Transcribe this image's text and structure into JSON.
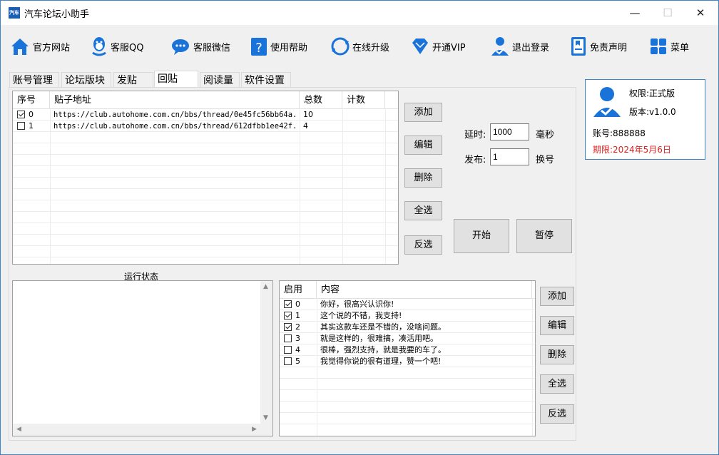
{
  "window": {
    "title": "汽车论坛小助手",
    "icon_text": "汽车",
    "minimize": "—",
    "maximize": "☐",
    "close": "✕"
  },
  "toolbar": [
    {
      "label": "官方网站",
      "icon": "home-icon"
    },
    {
      "label": "客服QQ",
      "icon": "qq-icon"
    },
    {
      "label": "客服微信",
      "icon": "wechat-icon"
    },
    {
      "label": "使用帮助",
      "icon": "help-icon"
    },
    {
      "label": "在线升级",
      "icon": "refresh-icon"
    },
    {
      "label": "开通VIP",
      "icon": "diamond-icon"
    },
    {
      "label": "退出登录",
      "icon": "user-logout-icon"
    },
    {
      "label": "免责声明",
      "icon": "document-icon"
    },
    {
      "label": "菜单",
      "icon": "grid-menu-icon"
    }
  ],
  "tabs": [
    "账号管理",
    "论坛版块",
    "发贴",
    "回贴",
    "阅读量",
    "软件设置"
  ],
  "active_tab": "回贴",
  "posts_table": {
    "headers": [
      "序号",
      "贴子地址",
      "总数",
      "计数"
    ],
    "rows": [
      {
        "checked": true,
        "index": "0",
        "url": "https://club.autohome.com.cn/bbs/thread/0e45fc56bb64a...",
        "total": "10",
        "count": ""
      },
      {
        "checked": false,
        "index": "1",
        "url": "https://club.autohome.com.cn/bbs/thread/612dfbb1ee42f...",
        "total": "4",
        "count": ""
      }
    ]
  },
  "posts_buttons": {
    "add": "添加",
    "edit": "编辑",
    "delete": "删除",
    "select_all": "全选",
    "invert": "反选"
  },
  "settings": {
    "delay_label": "延时:",
    "delay_value": "1000",
    "delay_unit": "毫秒",
    "publish_label": "发布:",
    "publish_value": "1",
    "publish_unit": "换号"
  },
  "actions": {
    "start": "开始",
    "pause": "暂停"
  },
  "account": {
    "permission": "权限:正式版",
    "version": "版本:v1.0.0",
    "account_no": "账号:888888",
    "expiry": "期限:2024年5月6日"
  },
  "status": {
    "label": "运行状态"
  },
  "content_table": {
    "headers": [
      "启用",
      "内容"
    ],
    "rows": [
      {
        "checked": true,
        "index": "0",
        "text": "你好，很高兴认识你!"
      },
      {
        "checked": true,
        "index": "1",
        "text": "这个说的不错，我支持!"
      },
      {
        "checked": true,
        "index": "2",
        "text": "其实这款车还是不错的，没啥问题。"
      },
      {
        "checked": false,
        "index": "3",
        "text": "就是这样的，很难搞，凑活用吧。"
      },
      {
        "checked": false,
        "index": "4",
        "text": "很棒，强烈支持，就是我要的车了。"
      },
      {
        "checked": false,
        "index": "5",
        "text": "我觉得你说的很有道理，赞一个吧!"
      }
    ]
  },
  "content_buttons": {
    "add": "添加",
    "edit": "编辑",
    "delete": "删除",
    "select_all": "全选",
    "invert": "反选"
  },
  "colors": {
    "accent": "#1a73d9",
    "expiry": "#e02020",
    "panel_border": "#3c86c9"
  }
}
